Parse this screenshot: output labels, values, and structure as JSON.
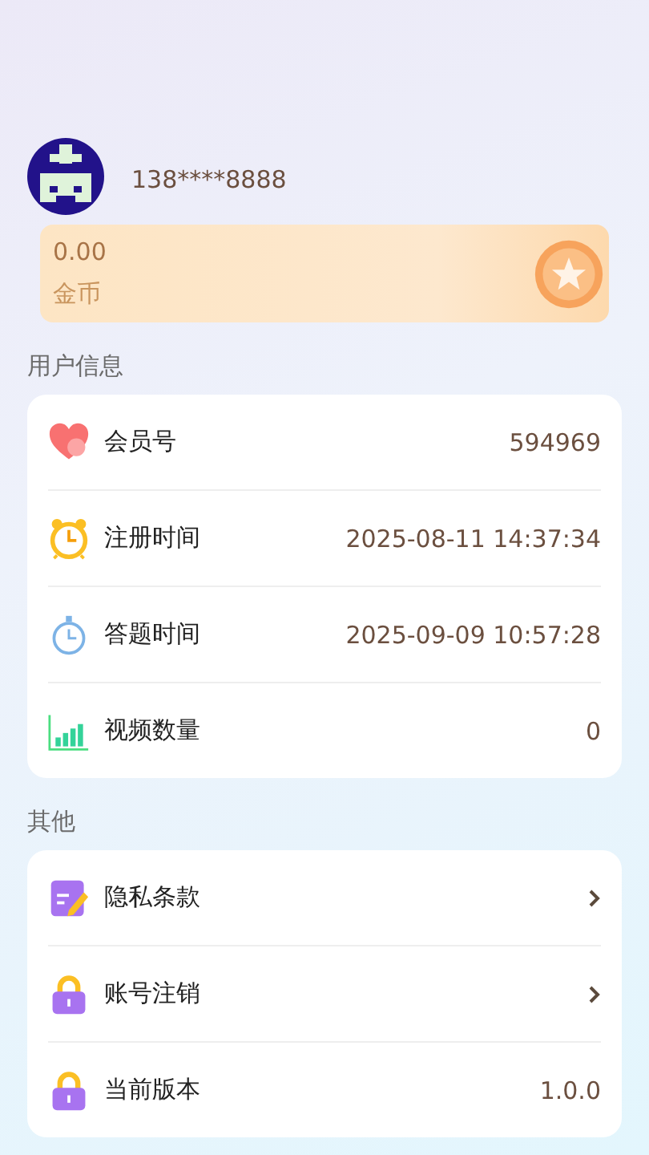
{
  "profile": {
    "phone": "138****8888"
  },
  "coins": {
    "amount": "0.00",
    "label": "金币"
  },
  "user_info": {
    "title": "用户信息",
    "rows": [
      {
        "label": "会员号",
        "value": "594969"
      },
      {
        "label": "注册时间",
        "value": "2025-08-11 14:37:34"
      },
      {
        "label": "答题时间",
        "value": "2025-09-09 10:57:28"
      },
      {
        "label": "视频数量",
        "value": "0"
      }
    ]
  },
  "other": {
    "title": "其他",
    "rows": [
      {
        "kind": "link",
        "label": "隐私条款"
      },
      {
        "kind": "link",
        "label": "账号注销"
      },
      {
        "kind": "value",
        "label": "当前版本",
        "value": "1.0.0"
      }
    ]
  }
}
